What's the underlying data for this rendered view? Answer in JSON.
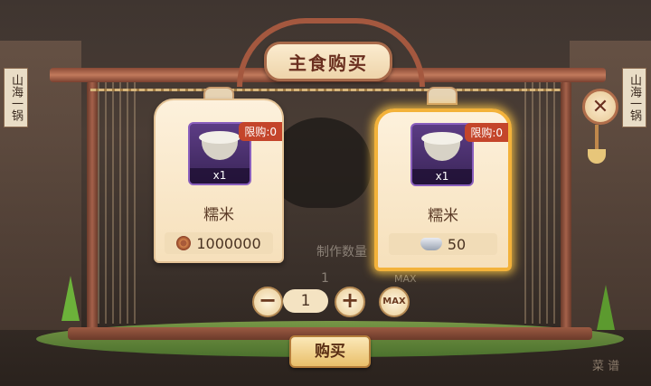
{
  "title": "主食购买",
  "background": {
    "left_banner_text": "山海一锅",
    "right_banner_text": "山海一锅",
    "ghost_label": "制作数量",
    "ghost_qty": "1",
    "ghost_max": "MAX"
  },
  "close_icon": "close-icon",
  "cards": [
    {
      "name": "糯米",
      "quantity": "x1",
      "limit": "限购:0",
      "currency_icon": "copper-coin-icon",
      "price": "1000000",
      "selected": false
    },
    {
      "name": "糯米",
      "quantity": "x1",
      "limit": "限购:0",
      "currency_icon": "silver-ingot-icon",
      "price": "50",
      "selected": true
    }
  ],
  "stepper": {
    "minus": "−",
    "value": "1",
    "plus": "+",
    "max": "MAX"
  },
  "buy_label": "购买",
  "recipe_label": "菜 谱",
  "colors": {
    "accent_border": "#f3b23a",
    "card_bg": "#fdf1dc",
    "item_slot": "#5c3c84",
    "limit_badge": "#c4452b"
  }
}
